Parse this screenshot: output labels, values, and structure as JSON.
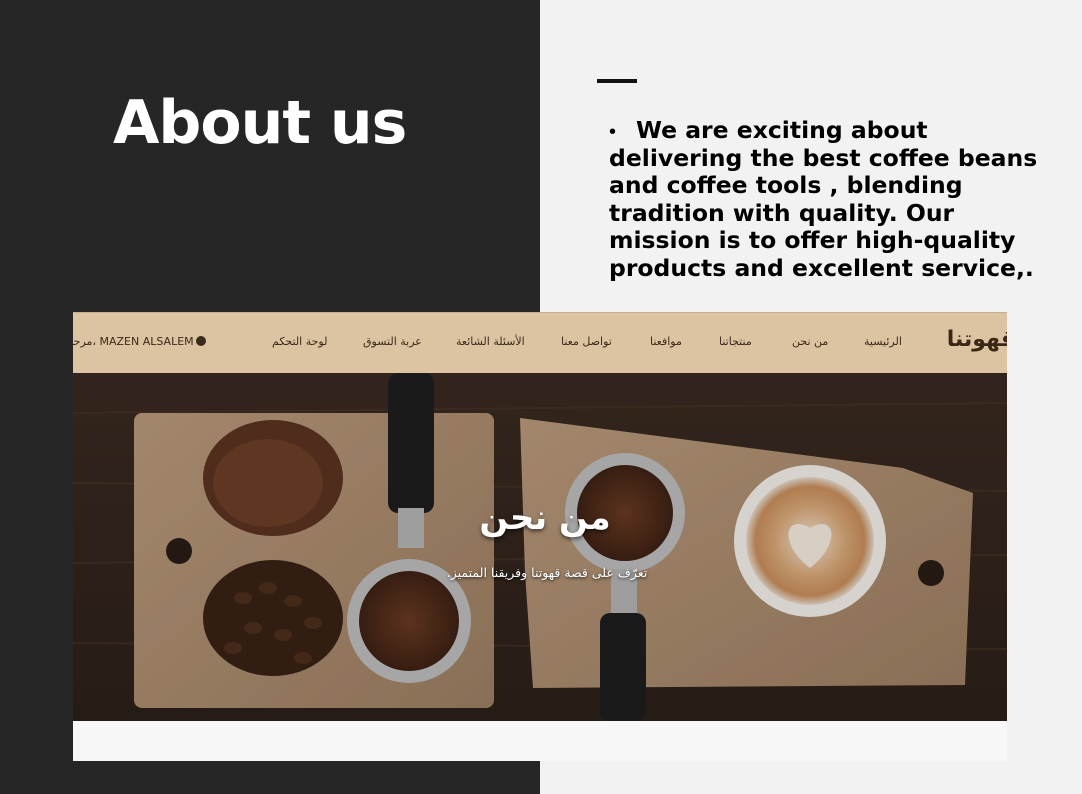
{
  "slide": {
    "title": "About us",
    "body": "We are exciting about delivering the best coffee beans and coffee tools , blending tradition with quality. Our mission is to offer high-quality products and excellent service,.",
    "bullet": "•"
  },
  "site": {
    "logo": "قهوتنا",
    "nav": {
      "home": "الرئيسية",
      "about": "من نحن",
      "products": "منتجاتنا",
      "locations": "موافعنا",
      "contact": "تواصل معنا",
      "faq": "الأسئلة الشائعة",
      "cart": "عربة التسوق",
      "dashboard": "لوحة التحكم"
    },
    "greeting": "مرحباً، MAZEN ALSALEM",
    "hero": {
      "title": "من نحن",
      "subtitle": "تعرّف على قصة قهوتنا وفريقنا المتميز."
    }
  },
  "colors": {
    "left_panel": "#262626",
    "right_panel": "#f2f2f2",
    "nav_background": "#dcc4a2",
    "wood_dark": "#3b2a20",
    "board": "#b8987a"
  },
  "icons": {
    "user": "user-circle-icon"
  }
}
